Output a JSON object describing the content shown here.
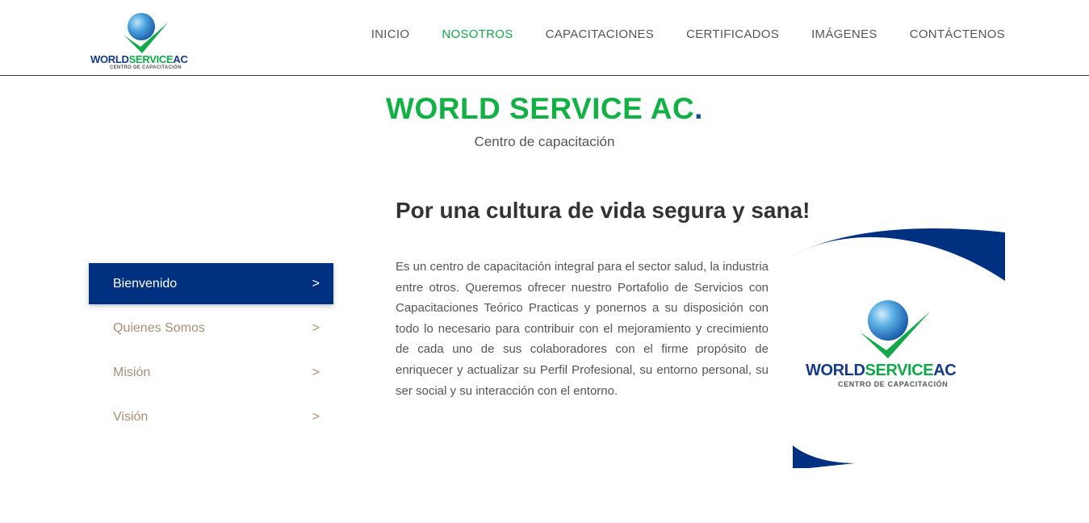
{
  "header": {
    "logo": {
      "brand_part1": "WORLD",
      "brand_part2": "SERVICE",
      "brand_part3": "AC",
      "subtitle": "CENTRO DE CAPACITACIÓN"
    },
    "nav": [
      {
        "label": "INICIO",
        "active": false
      },
      {
        "label": "NOSOTROS",
        "active": true
      },
      {
        "label": "CAPACITACIONES",
        "active": false
      },
      {
        "label": "CERTIFICADOS",
        "active": false
      },
      {
        "label": "IMÁGENES",
        "active": false
      },
      {
        "label": "CONTÁCTENOS",
        "active": false
      }
    ]
  },
  "hero": {
    "title": "WORLD SERVICE AC",
    "title_dot": ".",
    "subtitle": "Centro de capacitación"
  },
  "tabs": [
    {
      "label": "Bienvenido",
      "arrow": ">",
      "active": true
    },
    {
      "label": "Quienes Somos",
      "arrow": ">",
      "active": false
    },
    {
      "label": "Misión",
      "arrow": ">",
      "active": false
    },
    {
      "label": "Visión",
      "arrow": ">",
      "active": false
    }
  ],
  "content": {
    "heading": "Por una cultura de vida segura y sana!",
    "paragraph": "Es un centro de capacitación integral para el sector salud, la industria entre otros. Queremos ofrecer nuestro Portafolio de Servicios con Capacitaciones Teórico Practicas y ponernos a su disposición con todo lo necesario para contribuir con el mejoramiento y crecimiento de cada uno de sus colaboradores con el firme propósito de enriquecer y actualizar su Perfil Profesional, su entorno personal, su ser social y su interacción con el entorno."
  },
  "image": {
    "brand_part1": "WORLD",
    "brand_part2": "SERVICE",
    "brand_part3": "AC",
    "subtitle": "CENTRO DE CAPACITACIÓN"
  },
  "colors": {
    "accent_green": "#12b045",
    "brand_blue": "#003180",
    "tab_text": "#a88e78"
  }
}
